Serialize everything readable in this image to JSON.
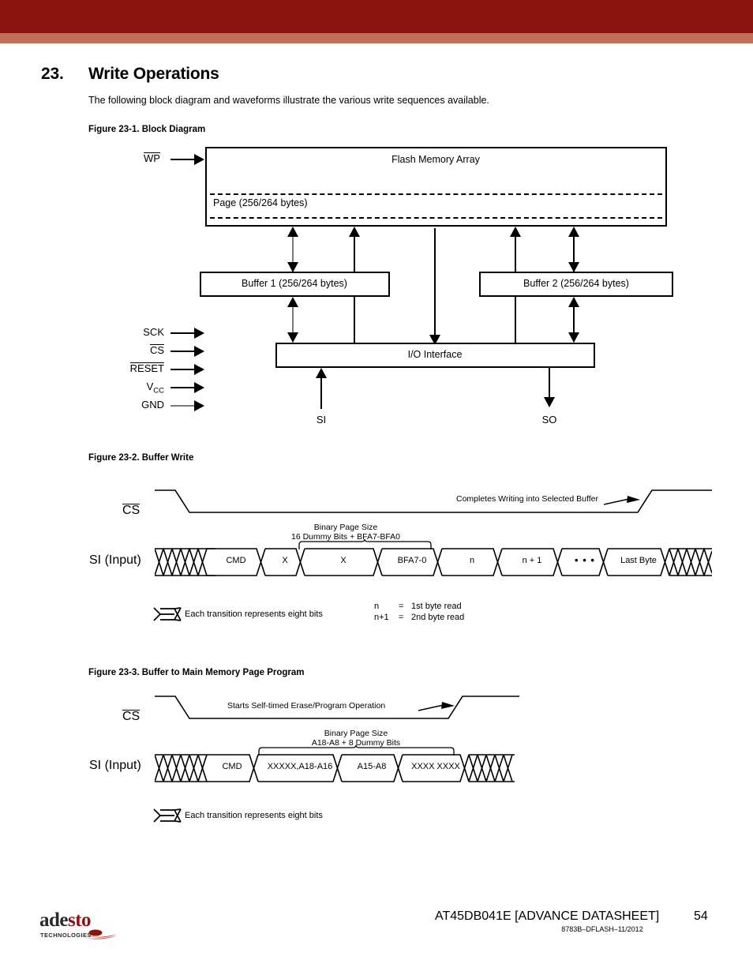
{
  "banner": {
    "dark_color": "#8b1411",
    "light_color": "#c16f59"
  },
  "section": {
    "number": "23.",
    "title": "Write Operations",
    "intro": "The following block diagram and waveforms illustrate the various write sequences available."
  },
  "figure1": {
    "caption": "Figure 23-1.  Block Diagram",
    "blocks": {
      "flash_array": "Flash Memory Array",
      "page": "Page (256/264 bytes)",
      "buffer1": "Buffer 1 (256/264 bytes)",
      "buffer2": "Buffer 2 (256/264 bytes)",
      "io_interface": "I/O Interface"
    },
    "top_pin": "WP",
    "pins": [
      "SCK",
      "CS",
      "RESET",
      "VCC",
      "GND"
    ],
    "pin_vcc_base": "V",
    "pin_vcc_sub": "CC",
    "bottom_labels": {
      "si": "SI",
      "so": "SO"
    }
  },
  "figure2": {
    "caption": "Figure 23-2.  Buffer Write",
    "cs_label": "CS",
    "si_label": "SI (Input)",
    "cs_annotation": "Completes Writing into Selected Buffer",
    "brace_line1": "Binary Page Size",
    "brace_line2": "16 Dummy Bits + BFA7-BFA0",
    "cells": [
      "CMD",
      "X",
      "X",
      "BFA7-0",
      "n",
      "n + 1",
      "• • •",
      "Last Byte"
    ],
    "legend": "Each transition represents eight bits",
    "notes": [
      {
        "sym": "n",
        "eq": "=",
        "txt": "1st byte read"
      },
      {
        "sym": "n+1",
        "eq": "=",
        "txt": "2nd byte read"
      }
    ]
  },
  "figure3": {
    "caption": "Figure 23-3.  Buffer to Main Memory Page Program",
    "cs_label": "CS",
    "si_label": "SI (Input)",
    "cs_annotation": "Starts Self-timed Erase/Program Operation",
    "brace_line1": "Binary Page Size",
    "brace_line2": "A18-A8 + 8 Dummy Bits",
    "cells": [
      "CMD",
      "XXXXX,A18-A16",
      "A15-A8",
      "XXXX XXXX"
    ],
    "legend": "Each transition represents eight bits"
  },
  "footer": {
    "logo_part1": "ade",
    "logo_part2": "sto",
    "logo_sub": "TECHNOLOGIES",
    "title": "AT45DB041E [ADVANCE DATASHEET]",
    "page": "54",
    "doc_code": "8783B–DFLASH–11/2012"
  }
}
